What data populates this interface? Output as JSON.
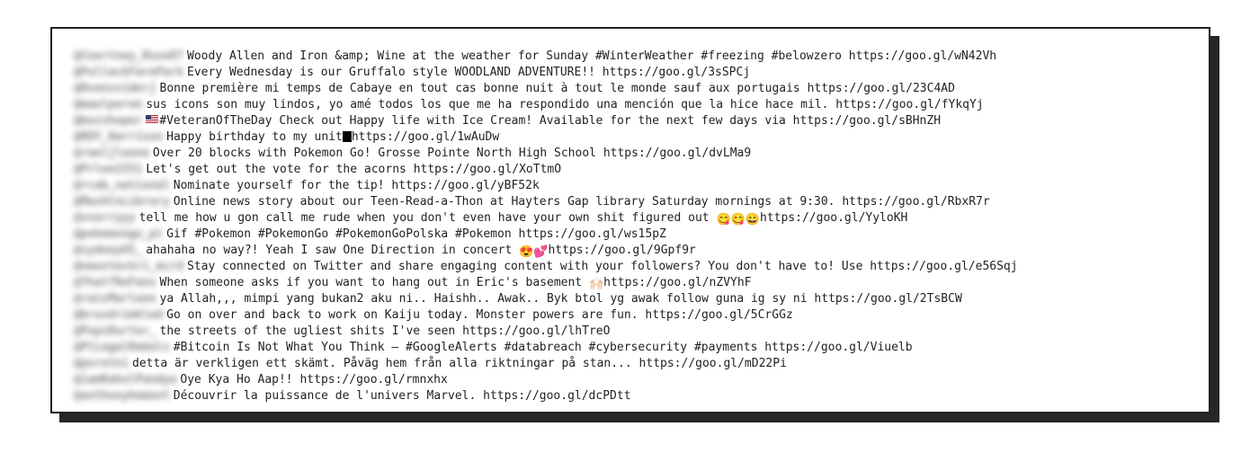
{
  "rows": [
    {
      "handle": "@Courtney_Rose87",
      "pre_emoji": null,
      "text": "Woody Allen and Iron &amp; Wine at the weather for Sunday #WinterWeather #freezing #belowzero https://goo.gl/wN42Vh"
    },
    {
      "handle": "@PullackFarePark",
      "pre_emoji": null,
      "text": "Every Wednesday is our Gruffalo style WOODLAND ADVENTURE!! https://goo.gl/3sSPCj"
    },
    {
      "handle": "@Dvensviderj",
      "pre_emoji": null,
      "text": "Bonne première mi temps de Cabaye en tout cas bonne nuit à tout le monde sauf aux portugais https://goo.gl/23C4AD"
    },
    {
      "handle": "@maulperen",
      "pre_emoji": null,
      "text": "sus icons son muy lindos, yo amé todos los que me ha respondido una mención que la hice hace mil. https://goo.gl/fYkqYj"
    },
    {
      "handle": "@buzzhoper",
      "pre_emoji": "flag",
      "text": "#VeteranOfTheDay Check out Happy life with Ice Cream! Available for the next few days via https://goo.gl/sBHnZH"
    },
    {
      "handle": "@RDY_Harrison",
      "pre_emoji": null,
      "text": "Happy birthday to my unit",
      "inline_emoji": "blackbox",
      "post": "https://goo.gl/1wAuDw"
    },
    {
      "handle": "@raeljleene",
      "pre_emoji": null,
      "text": "Over 20 blocks with Pokemon Go! Grosse Pointe North High School https://goo.gl/dvLMa9"
    },
    {
      "handle": "@Prlee1551",
      "pre_emoji": null,
      "text": "Let's get out the vote for the acorns https://goo.gl/XoTtmO"
    },
    {
      "handle": "@rcab_national",
      "pre_emoji": null,
      "text": "Nominate yourself for the tip! https://goo.gl/yBF52k"
    },
    {
      "handle": "@MashCoLibrary",
      "pre_emoji": null,
      "text": "Online news story about our Teen-Read-a-Thon at Hayters Gap library Saturday mornings at 9:30. https://goo.gl/RbxR7r"
    },
    {
      "handle": "@vverryyy",
      "pre_emoji": null,
      "text": "tell me how u gon call me rude when you don't even have your own shit figured out ",
      "inline_emoji": "😋😋😄",
      "post": "https://goo.gl/YyloKH"
    },
    {
      "handle": "@pokemongo_pl",
      "pre_emoji": null,
      "text": "Gif #Pokemon #PokemonGo #PokemonGoPolska #Pokemon https://goo.gl/ws15pZ"
    },
    {
      "handle": "@sydney65_",
      "pre_emoji": null,
      "text": "ahahaha no way?! Yeah I saw One Direction in concert ",
      "inline_emoji": "😍💕",
      "post": "https://goo.gl/9Gpf9r"
    },
    {
      "handle": "@newstechri_mcrd",
      "pre_emoji": null,
      "text": "Stay connected on Twitter and share engaging content with your followers? You don't have to! Use https://goo.gl/e56Sqj"
    },
    {
      "handle": "@That7NoFans",
      "pre_emoji": null,
      "text": "When someone asks if you want to hang out in Eric's basement ",
      "inline_emoji": "🙌🏻",
      "post": "https://goo.gl/nZVYhF"
    },
    {
      "handle": "@raisMarleen",
      "pre_emoji": null,
      "text": "ya Allah,,, mimpi yang bukan2 aku ni.. Haishh.. Awak.. Byk btol yg awak follow guna ig sy ni https://goo.gl/2TsBCW"
    },
    {
      "handle": "@brusdrimkled",
      "pre_emoji": null,
      "text": "Go on over and back to work on Kaiju today. Monster powers are fun. https://goo.gl/5CrGGz"
    },
    {
      "handle": "@PopsDurter_",
      "pre_emoji": null,
      "text": "the streets of the ugliest shits I've seen https://goo.gl/lhTreO"
    },
    {
      "handle": "@PlLegalRebels",
      "pre_emoji": null,
      "text": "#Bitcoin Is Not What You Think – #GoogleAlerts #databreach #cybersecurity #payments https://goo.gl/Viuelb"
    },
    {
      "handle": "@poretni",
      "pre_emoji": null,
      "text": "detta är verkligen ett skämt. Påväg hem från alla riktningar på stan... https://goo.gl/mD22Pi"
    },
    {
      "handle": "@iamRahulPandya",
      "pre_emoji": null,
      "text": "Oye Kya Ho Aap!! https://goo.gl/rmnxhx"
    },
    {
      "handle": "@anthonyhemont",
      "pre_emoji": null,
      "text": "Découvrir la puissance de l'univers Marvel. https://goo.gl/dcPDtt"
    }
  ]
}
